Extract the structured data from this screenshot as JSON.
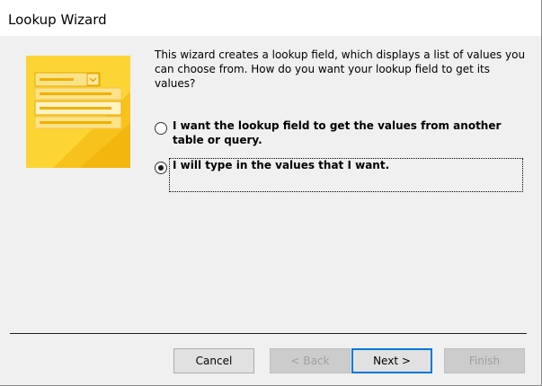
{
  "window": {
    "title": "Lookup Wizard"
  },
  "intro": {
    "text": "This wizard creates a lookup field, which displays a list of values you can choose from.  How do you want your lookup field to get its values?"
  },
  "options": [
    {
      "label": "I want the lookup field to get the values from another table or query.",
      "selected": false
    },
    {
      "label": "I will type in the values that I want.",
      "selected": true
    }
  ],
  "buttons": {
    "cancel": "Cancel",
    "back": "< Back",
    "next": "Next >",
    "finish": "Finish"
  },
  "icons": {
    "wizard_art": "lookup-field-illustration-icon"
  },
  "colors": {
    "art_yellow": "#fcd535",
    "default_button_border": "#0078d7"
  }
}
